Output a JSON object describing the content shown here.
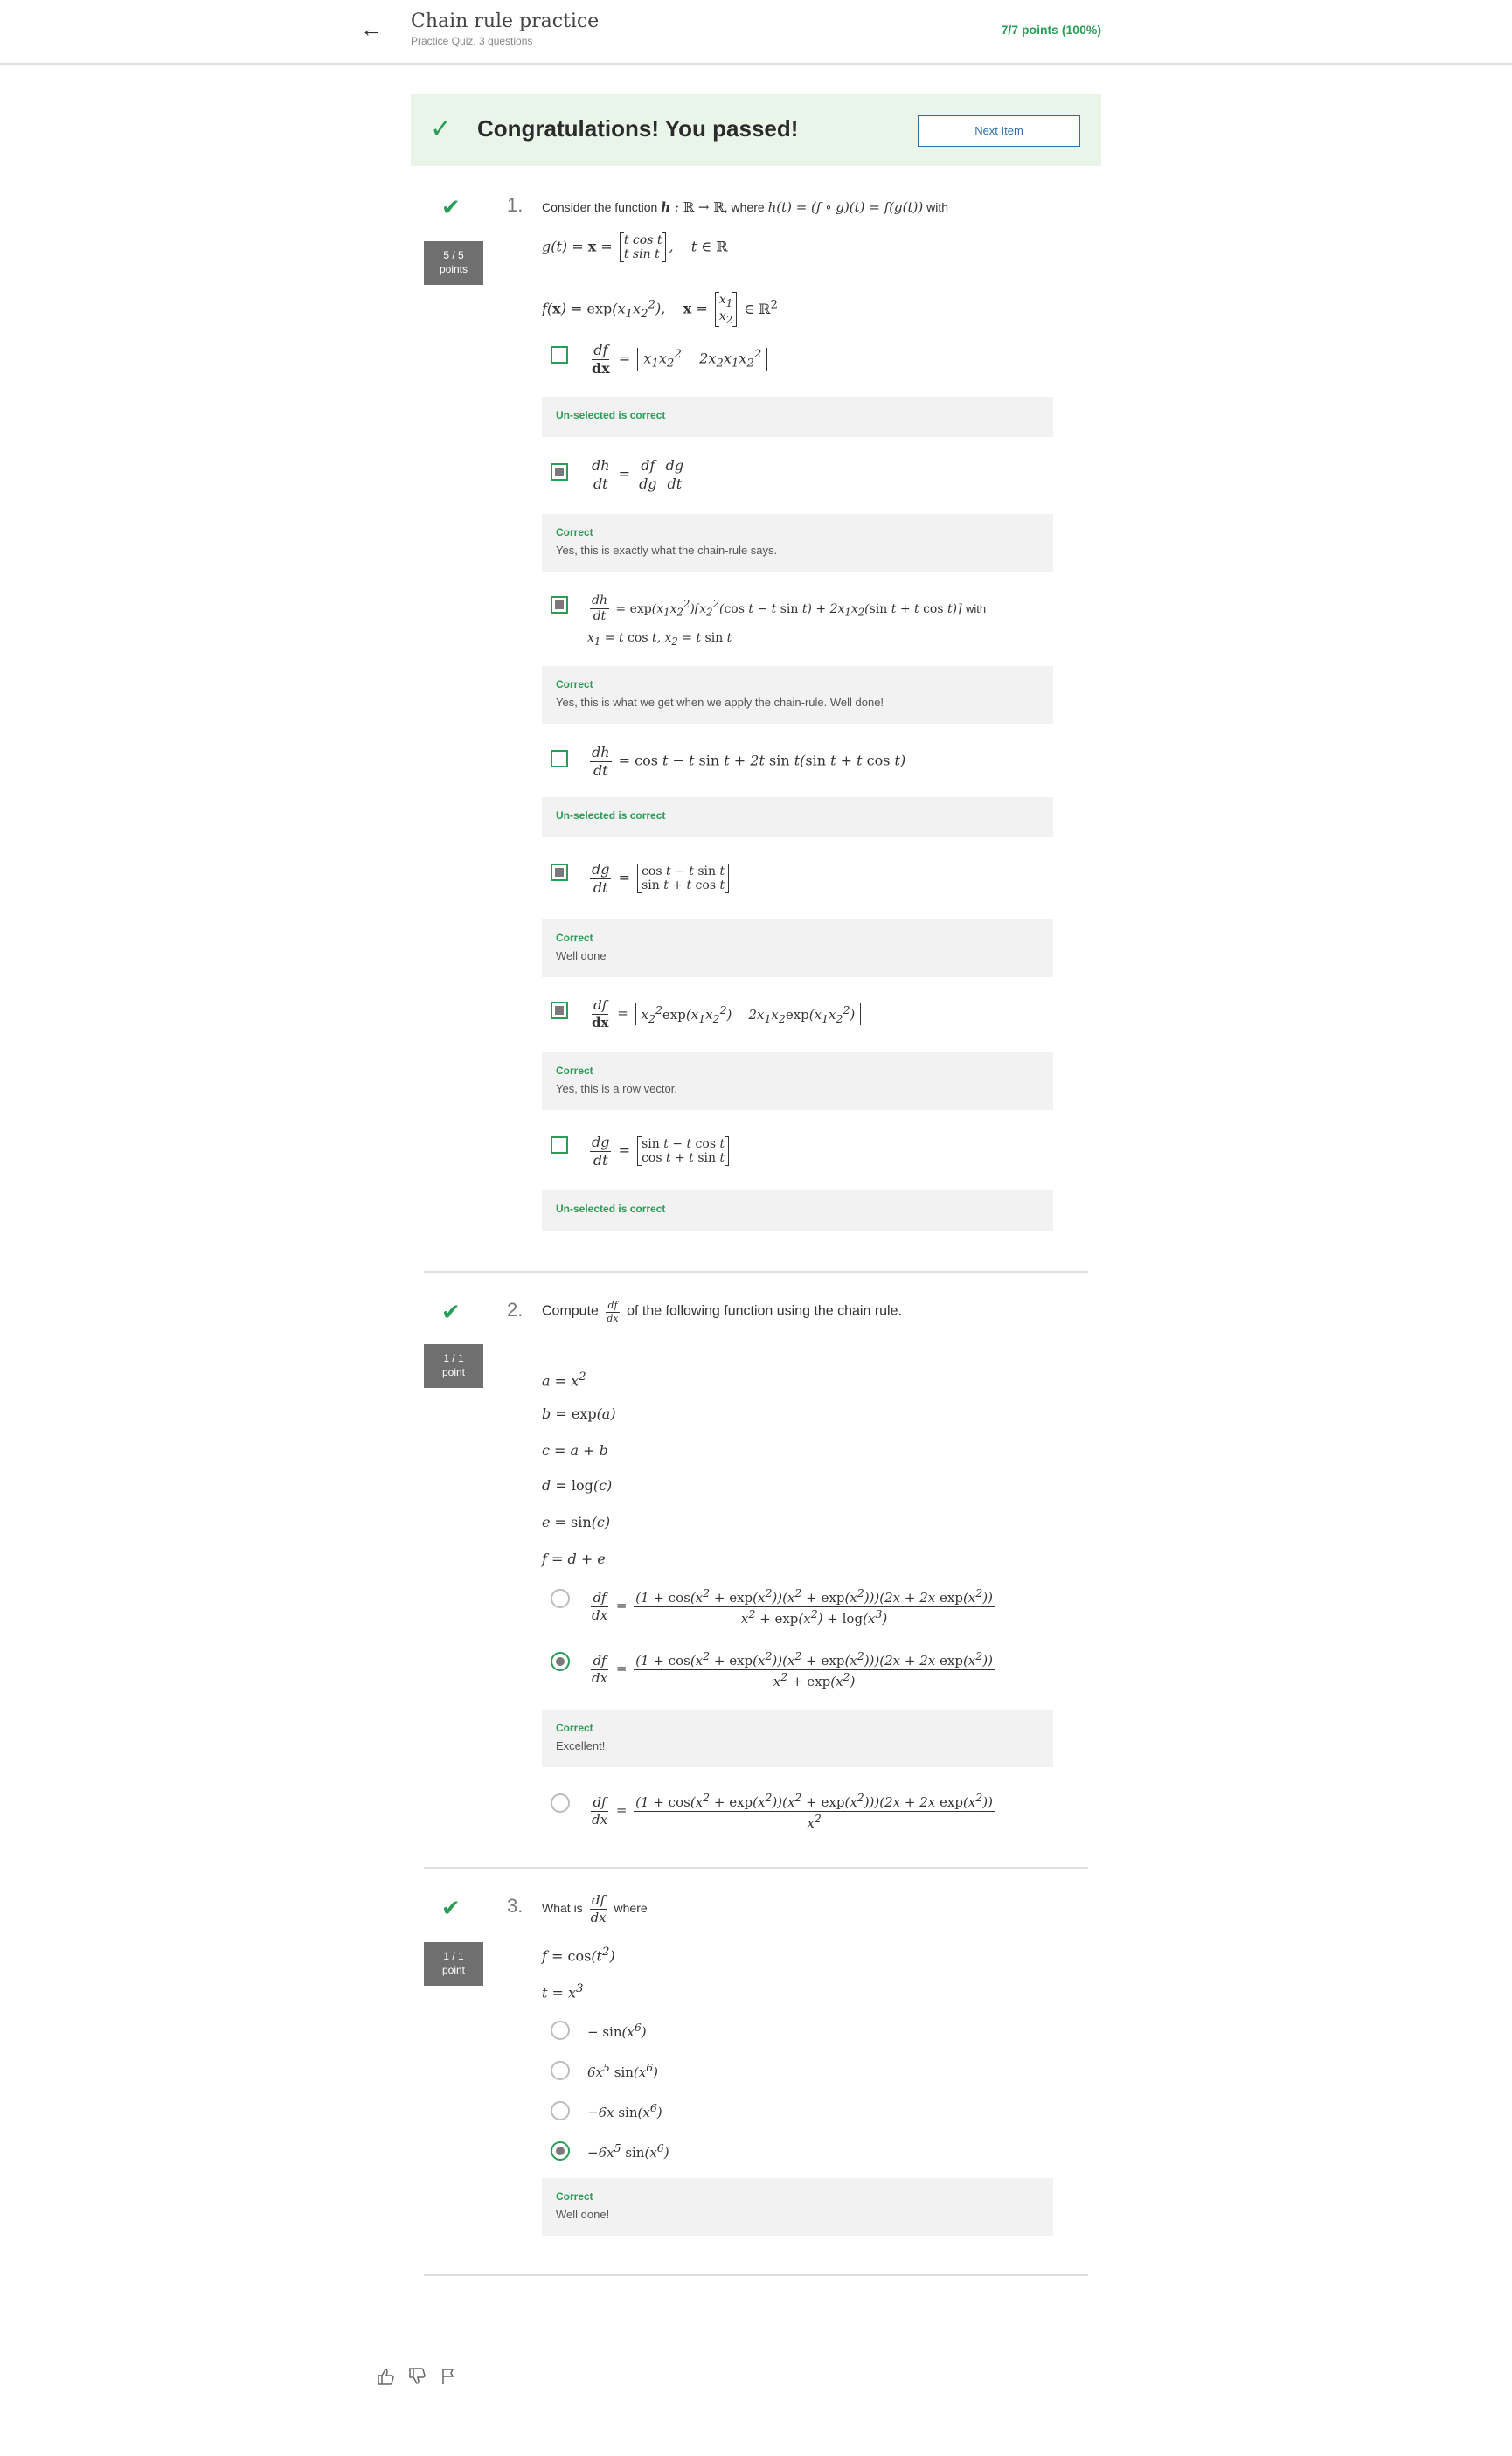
{
  "header": {
    "title": "Chain rule practice",
    "subtitle": "Practice Quiz, 3 questions",
    "score": "7/7 points (100%)"
  },
  "banner": {
    "message": "Congratulations! You passed!",
    "next_label": "Next Item"
  },
  "q1": {
    "number": "1.",
    "badge_score": "5 / 5",
    "badge_unit": "points",
    "prompt_prefix": "Consider the function",
    "prompt_where": ", where",
    "prompt_with": "with",
    "options": [
      {
        "checked": false,
        "feedback_title": "Un-selected is correct",
        "feedback_body": ""
      },
      {
        "checked": true,
        "feedback_title": "Correct",
        "feedback_body": "Yes, this is exactly what the chain-rule says."
      },
      {
        "checked": true,
        "feedback_title": "Correct",
        "feedback_body": "Yes, this is what we get when we apply the chain-rule. Well done!"
      },
      {
        "checked": false,
        "feedback_title": "Un-selected is correct",
        "feedback_body": ""
      },
      {
        "checked": true,
        "feedback_title": "Correct",
        "feedback_body": "Well done"
      },
      {
        "checked": true,
        "feedback_title": "Correct",
        "feedback_body": "Yes, this is a row vector."
      },
      {
        "checked": false,
        "feedback_title": "Un-selected is correct",
        "feedback_body": ""
      }
    ],
    "opt3_with": "with"
  },
  "q2": {
    "number": "2.",
    "badge_score": "1 / 1",
    "badge_unit": "point",
    "prompt_prefix": "Compute",
    "prompt_suffix": "of the following function using the chain rule.",
    "feedback_title": "Correct",
    "feedback_body": "Excellent!"
  },
  "q3": {
    "number": "3.",
    "badge_score": "1 / 1",
    "badge_unit": "point",
    "prompt_prefix": "What is",
    "prompt_suffix": "where",
    "feedback_title": "Correct",
    "feedback_body": "Well done!"
  },
  "icons": [
    "thumbs-up-icon",
    "thumbs-down-icon",
    "flag-icon",
    "back-arrow-icon",
    "check-icon"
  ]
}
